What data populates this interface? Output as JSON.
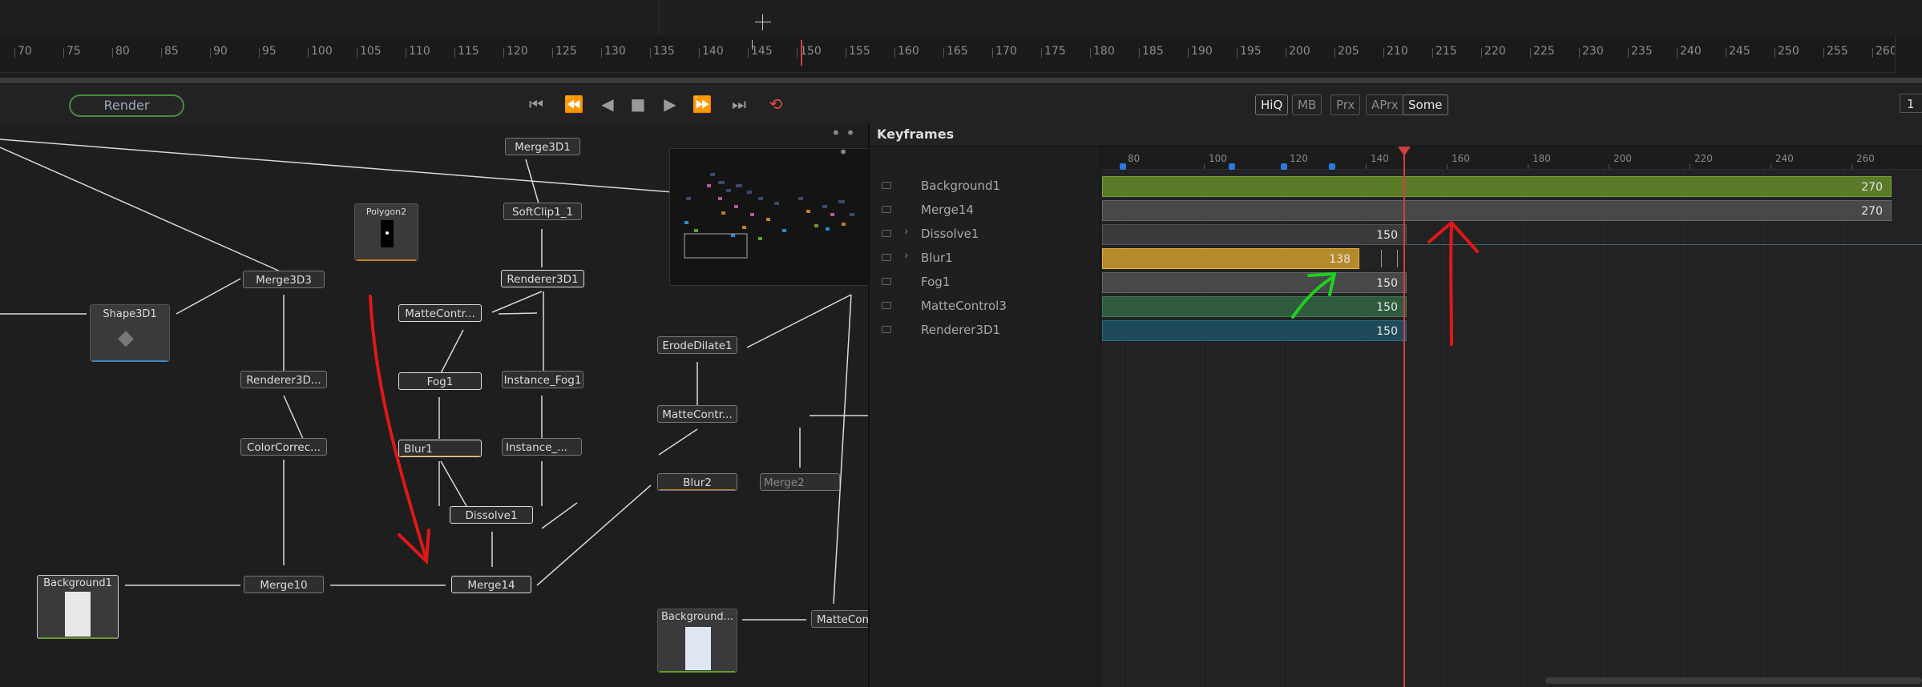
{
  "ruler": {
    "ticks": [
      "70",
      "75",
      "80",
      "85",
      "90",
      "95",
      "100",
      "105",
      "110",
      "115",
      "120",
      "125",
      "130",
      "135",
      "140",
      "145",
      "150",
      "155",
      "160",
      "165",
      "170",
      "175",
      "180",
      "185",
      "190",
      "195",
      "200",
      "205",
      "210",
      "215",
      "220",
      "225",
      "230",
      "235",
      "240",
      "245",
      "250",
      "255",
      "260"
    ],
    "end_value": ""
  },
  "transport": {
    "render_label": "Render",
    "quality": [
      "HiQ",
      "MB",
      "Prx",
      "APrx",
      "Some"
    ],
    "frame_value": "1"
  },
  "nodes": {
    "merge3d1": "Merge3D1",
    "polygon2": "Polygon2",
    "softclip1_1": "SoftClip1_1",
    "merge3d3": "Merge3D3",
    "renderer3d1": "Renderer3D1",
    "shape3d1": "Shape3D1",
    "mattecontrol_a": "MatteContr...",
    "erodedilate1": "ErodeDilate1",
    "renderer3d_b": "Renderer3D...",
    "fog1": "Fog1",
    "instance_fog1": "Instance_Fog1",
    "mattecontrol_b": "MatteContr...",
    "colorcorrect": "ColorCorrec...",
    "blur1": "Blur1",
    "instance_b": "Instance_...",
    "blur2": "Blur2",
    "merge2": "Merge2",
    "dissolve1": "Dissolve1",
    "background1": "Background1",
    "merge10": "Merge10",
    "merge14": "Merge14",
    "background_b": "Background...",
    "mattecon_c": "MatteCon"
  },
  "keyframes": {
    "title": "Keyframes",
    "ticks": [
      "80",
      "100",
      "120",
      "140",
      "160",
      "180",
      "200",
      "220",
      "240",
      "260"
    ],
    "rows": [
      {
        "name": "Background1",
        "value": "270"
      },
      {
        "name": "Merge14",
        "value": "270"
      },
      {
        "name": "Dissolve1",
        "value": "150"
      },
      {
        "name": "Blur1",
        "value": "138"
      },
      {
        "name": "Fog1",
        "value": "150"
      },
      {
        "name": "MatteControl3",
        "value": "150"
      },
      {
        "name": "Renderer3D1",
        "value": "150"
      }
    ]
  },
  "colors": {
    "annotation_red": "#e01818",
    "annotation_green": "#20d020",
    "accent_green": "#6a8e2e",
    "accent_orange": "#c08020",
    "playhead_red": "#d04040"
  }
}
